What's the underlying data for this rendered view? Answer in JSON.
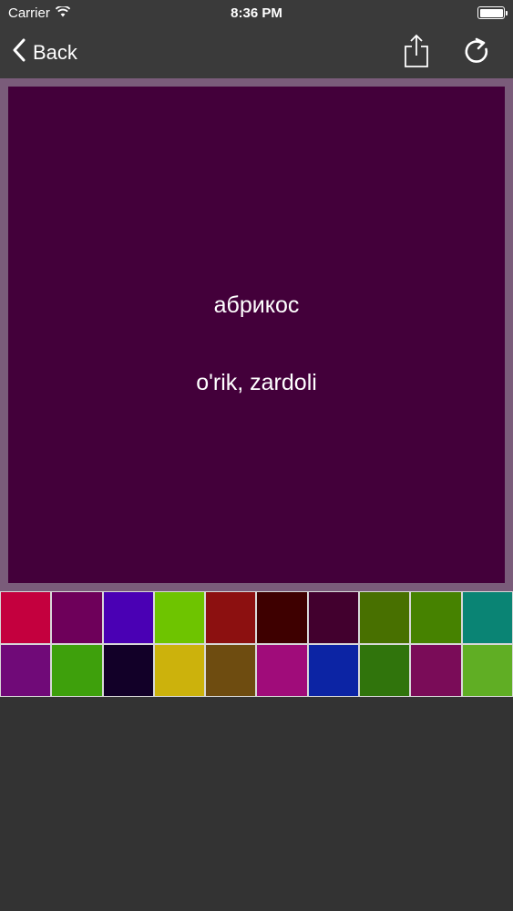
{
  "status_bar": {
    "carrier": "Carrier",
    "time": "8:36 PM",
    "wifi_icon": "wifi-icon",
    "battery_icon": "battery-icon"
  },
  "nav": {
    "back_label": "Back",
    "back_icon": "chevron-left-icon",
    "share_icon": "share-icon",
    "refresh_icon": "refresh-icon"
  },
  "card": {
    "background": "#43003a",
    "frame_color": "#7a5c7a",
    "word_ru": "абрикос",
    "word_uz": "o'rik, zardoli"
  },
  "palette": {
    "colors": [
      "#c4003e",
      "#6e005a",
      "#4a00b4",
      "#6ec400",
      "#8c1010",
      "#3e0000",
      "#42002e",
      "#487000",
      "#468200",
      "#0a8474",
      "#700a78",
      "#3ea00c",
      "#120028",
      "#ccb20c",
      "#6e4c10",
      "#a00c7a",
      "#0c24a4",
      "#30740c",
      "#7a0c58",
      "#60ae24"
    ]
  }
}
